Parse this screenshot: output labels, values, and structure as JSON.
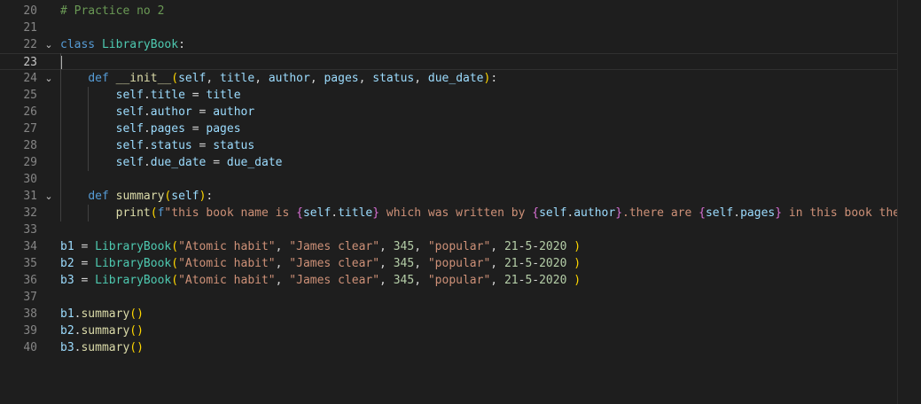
{
  "editor": {
    "colors": {
      "background": "#1e1e1e",
      "comment": "#6a9955",
      "keyword": "#569cd6",
      "class": "#4ec9b0",
      "function": "#dcdcaa",
      "variable": "#9cdcfe",
      "string": "#ce9178",
      "number": "#b5cea8"
    },
    "current_line": 23,
    "lines": [
      {
        "num": "20",
        "fold": "",
        "tokens": [
          {
            "t": "# Practice no 2",
            "c": "com"
          }
        ]
      },
      {
        "num": "21",
        "fold": "",
        "tokens": []
      },
      {
        "num": "22",
        "fold": "chevron-down",
        "tokens": [
          {
            "t": "class",
            "c": "kw"
          },
          {
            "t": " ",
            "c": "op"
          },
          {
            "t": "LibraryBook",
            "c": "cls"
          },
          {
            "t": ":",
            "c": "op"
          }
        ]
      },
      {
        "num": "23",
        "fold": "",
        "tokens": []
      },
      {
        "num": "24",
        "fold": "chevron-down",
        "tokens": [
          {
            "t": "    ",
            "c": "op"
          },
          {
            "t": "def",
            "c": "kw"
          },
          {
            "t": " ",
            "c": "op"
          },
          {
            "t": "__init__",
            "c": "fn"
          },
          {
            "t": "(",
            "c": "br1"
          },
          {
            "t": "self",
            "c": "var"
          },
          {
            "t": ", ",
            "c": "op"
          },
          {
            "t": "title",
            "c": "var"
          },
          {
            "t": ", ",
            "c": "op"
          },
          {
            "t": "author",
            "c": "var"
          },
          {
            "t": ", ",
            "c": "op"
          },
          {
            "t": "pages",
            "c": "var"
          },
          {
            "t": ", ",
            "c": "op"
          },
          {
            "t": "status",
            "c": "var"
          },
          {
            "t": ", ",
            "c": "op"
          },
          {
            "t": "due_date",
            "c": "var"
          },
          {
            "t": ")",
            "c": "br1"
          },
          {
            "t": ":",
            "c": "op"
          }
        ]
      },
      {
        "num": "25",
        "fold": "",
        "tokens": [
          {
            "t": "        ",
            "c": "op"
          },
          {
            "t": "self",
            "c": "var"
          },
          {
            "t": ".",
            "c": "op"
          },
          {
            "t": "title",
            "c": "var"
          },
          {
            "t": " = ",
            "c": "op"
          },
          {
            "t": "title",
            "c": "var"
          }
        ]
      },
      {
        "num": "26",
        "fold": "",
        "tokens": [
          {
            "t": "        ",
            "c": "op"
          },
          {
            "t": "self",
            "c": "var"
          },
          {
            "t": ".",
            "c": "op"
          },
          {
            "t": "author",
            "c": "var"
          },
          {
            "t": " = ",
            "c": "op"
          },
          {
            "t": "author",
            "c": "var"
          }
        ]
      },
      {
        "num": "27",
        "fold": "",
        "tokens": [
          {
            "t": "        ",
            "c": "op"
          },
          {
            "t": "self",
            "c": "var"
          },
          {
            "t": ".",
            "c": "op"
          },
          {
            "t": "pages",
            "c": "var"
          },
          {
            "t": " = ",
            "c": "op"
          },
          {
            "t": "pages",
            "c": "var"
          }
        ]
      },
      {
        "num": "28",
        "fold": "",
        "tokens": [
          {
            "t": "        ",
            "c": "op"
          },
          {
            "t": "self",
            "c": "var"
          },
          {
            "t": ".",
            "c": "op"
          },
          {
            "t": "status",
            "c": "var"
          },
          {
            "t": " = ",
            "c": "op"
          },
          {
            "t": "status",
            "c": "var"
          }
        ]
      },
      {
        "num": "29",
        "fold": "",
        "tokens": [
          {
            "t": "        ",
            "c": "op"
          },
          {
            "t": "self",
            "c": "var"
          },
          {
            "t": ".",
            "c": "op"
          },
          {
            "t": "due_date",
            "c": "var"
          },
          {
            "t": " = ",
            "c": "op"
          },
          {
            "t": "due_date",
            "c": "var"
          }
        ]
      },
      {
        "num": "30",
        "fold": "",
        "tokens": []
      },
      {
        "num": "31",
        "fold": "chevron-down",
        "tokens": [
          {
            "t": "    ",
            "c": "op"
          },
          {
            "t": "def",
            "c": "kw"
          },
          {
            "t": " ",
            "c": "op"
          },
          {
            "t": "summary",
            "c": "fn"
          },
          {
            "t": "(",
            "c": "br1"
          },
          {
            "t": "self",
            "c": "var"
          },
          {
            "t": ")",
            "c": "br1"
          },
          {
            "t": ":",
            "c": "op"
          }
        ]
      },
      {
        "num": "32",
        "fold": "",
        "tokens": [
          {
            "t": "        ",
            "c": "op"
          },
          {
            "t": "print",
            "c": "fn"
          },
          {
            "t": "(",
            "c": "br1"
          },
          {
            "t": "f",
            "c": "kw"
          },
          {
            "t": "\"this book name is ",
            "c": "str"
          },
          {
            "t": "{",
            "c": "br2"
          },
          {
            "t": "self",
            "c": "var"
          },
          {
            "t": ".",
            "c": "op"
          },
          {
            "t": "title",
            "c": "var"
          },
          {
            "t": "}",
            "c": "br2"
          },
          {
            "t": " which was written by ",
            "c": "str"
          },
          {
            "t": "{",
            "c": "br2"
          },
          {
            "t": "self",
            "c": "var"
          },
          {
            "t": ".",
            "c": "op"
          },
          {
            "t": "author",
            "c": "var"
          },
          {
            "t": "}",
            "c": "br2"
          },
          {
            "t": ".there are ",
            "c": "str"
          },
          {
            "t": "{",
            "c": "br2"
          },
          {
            "t": "self",
            "c": "var"
          },
          {
            "t": ".",
            "c": "op"
          },
          {
            "t": "pages",
            "c": "var"
          },
          {
            "t": "}",
            "c": "br2"
          },
          {
            "t": " in this book the s",
            "c": "str"
          }
        ]
      },
      {
        "num": "33",
        "fold": "",
        "tokens": []
      },
      {
        "num": "34",
        "fold": "",
        "tokens": [
          {
            "t": "b1",
            "c": "var"
          },
          {
            "t": " = ",
            "c": "op"
          },
          {
            "t": "LibraryBook",
            "c": "cls"
          },
          {
            "t": "(",
            "c": "br1"
          },
          {
            "t": "\"Atomic habit\"",
            "c": "str"
          },
          {
            "t": ", ",
            "c": "op"
          },
          {
            "t": "\"James clear\"",
            "c": "str"
          },
          {
            "t": ", ",
            "c": "op"
          },
          {
            "t": "345",
            "c": "num"
          },
          {
            "t": ", ",
            "c": "op"
          },
          {
            "t": "\"popular\"",
            "c": "str"
          },
          {
            "t": ", ",
            "c": "op"
          },
          {
            "t": "21",
            "c": "num"
          },
          {
            "t": "-",
            "c": "op"
          },
          {
            "t": "5",
            "c": "num"
          },
          {
            "t": "-",
            "c": "op"
          },
          {
            "t": "2020",
            "c": "num"
          },
          {
            "t": " ",
            "c": "op"
          },
          {
            "t": ")",
            "c": "br1"
          }
        ]
      },
      {
        "num": "35",
        "fold": "",
        "tokens": [
          {
            "t": "b2",
            "c": "var"
          },
          {
            "t": " = ",
            "c": "op"
          },
          {
            "t": "LibraryBook",
            "c": "cls"
          },
          {
            "t": "(",
            "c": "br1"
          },
          {
            "t": "\"Atomic habit\"",
            "c": "str"
          },
          {
            "t": ", ",
            "c": "op"
          },
          {
            "t": "\"James clear\"",
            "c": "str"
          },
          {
            "t": ", ",
            "c": "op"
          },
          {
            "t": "345",
            "c": "num"
          },
          {
            "t": ", ",
            "c": "op"
          },
          {
            "t": "\"popular\"",
            "c": "str"
          },
          {
            "t": ", ",
            "c": "op"
          },
          {
            "t": "21",
            "c": "num"
          },
          {
            "t": "-",
            "c": "op"
          },
          {
            "t": "5",
            "c": "num"
          },
          {
            "t": "-",
            "c": "op"
          },
          {
            "t": "2020",
            "c": "num"
          },
          {
            "t": " ",
            "c": "op"
          },
          {
            "t": ")",
            "c": "br1"
          }
        ]
      },
      {
        "num": "36",
        "fold": "",
        "tokens": [
          {
            "t": "b3",
            "c": "var"
          },
          {
            "t": " = ",
            "c": "op"
          },
          {
            "t": "LibraryBook",
            "c": "cls"
          },
          {
            "t": "(",
            "c": "br1"
          },
          {
            "t": "\"Atomic habit\"",
            "c": "str"
          },
          {
            "t": ", ",
            "c": "op"
          },
          {
            "t": "\"James clear\"",
            "c": "str"
          },
          {
            "t": ", ",
            "c": "op"
          },
          {
            "t": "345",
            "c": "num"
          },
          {
            "t": ", ",
            "c": "op"
          },
          {
            "t": "\"popular\"",
            "c": "str"
          },
          {
            "t": ", ",
            "c": "op"
          },
          {
            "t": "21",
            "c": "num"
          },
          {
            "t": "-",
            "c": "op"
          },
          {
            "t": "5",
            "c": "num"
          },
          {
            "t": "-",
            "c": "op"
          },
          {
            "t": "2020",
            "c": "num"
          },
          {
            "t": " ",
            "c": "op"
          },
          {
            "t": ")",
            "c": "br1"
          }
        ]
      },
      {
        "num": "37",
        "fold": "",
        "tokens": []
      },
      {
        "num": "38",
        "fold": "",
        "tokens": [
          {
            "t": "b1",
            "c": "var"
          },
          {
            "t": ".",
            "c": "op"
          },
          {
            "t": "summary",
            "c": "fn"
          },
          {
            "t": "()",
            "c": "br1"
          }
        ]
      },
      {
        "num": "39",
        "fold": "",
        "tokens": [
          {
            "t": "b2",
            "c": "var"
          },
          {
            "t": ".",
            "c": "op"
          },
          {
            "t": "summary",
            "c": "fn"
          },
          {
            "t": "()",
            "c": "br1"
          }
        ]
      },
      {
        "num": "40",
        "fold": "",
        "tokens": [
          {
            "t": "b3",
            "c": "var"
          },
          {
            "t": ".",
            "c": "op"
          },
          {
            "t": "summary",
            "c": "fn"
          },
          {
            "t": "()",
            "c": "br1"
          }
        ]
      }
    ]
  }
}
